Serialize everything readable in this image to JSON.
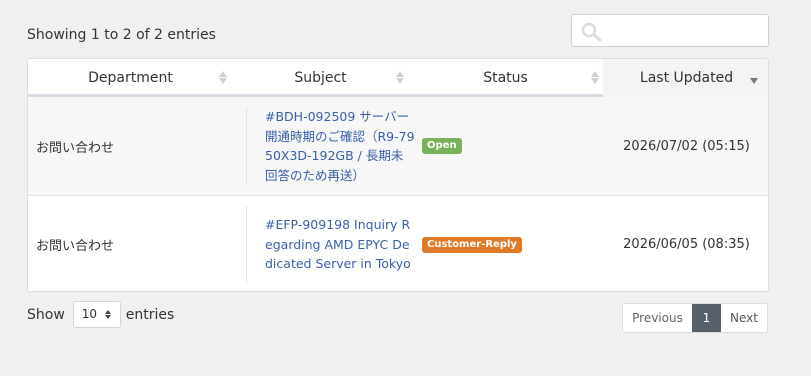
{
  "info": {
    "showing_text": "Showing 1 to 2 of 2 entries"
  },
  "search": {
    "placeholder": "",
    "icon": "search-icon"
  },
  "table": {
    "columns": [
      {
        "label": "Department"
      },
      {
        "label": "Subject"
      },
      {
        "label": "Status"
      },
      {
        "label": "Last Updated",
        "sorted": "desc"
      }
    ],
    "rows": [
      {
        "department": "お問い合わせ",
        "subject": "#BDH-092509 サーバー開通時期のご確認（R9-7950X3D-192GB / 長期未回答のため再送）",
        "status": "Open",
        "status_color": "#7ab25b",
        "last_updated": "2026/07/02 (05:15)"
      },
      {
        "department": "お問い合わせ",
        "subject": "#EFP-909198 Inquiry Regarding AMD EPYC Dedicated Server in Tokyo",
        "status": "Customer-Reply",
        "status_color": "#e07b2a",
        "last_updated": "2026/06/05 (08:35)"
      }
    ]
  },
  "length": {
    "show_label": "Show",
    "selected": "10",
    "entries_label": "entries"
  },
  "pagination": {
    "previous": "Previous",
    "current": "1",
    "next": "Next",
    "current_color": "#58606c"
  }
}
